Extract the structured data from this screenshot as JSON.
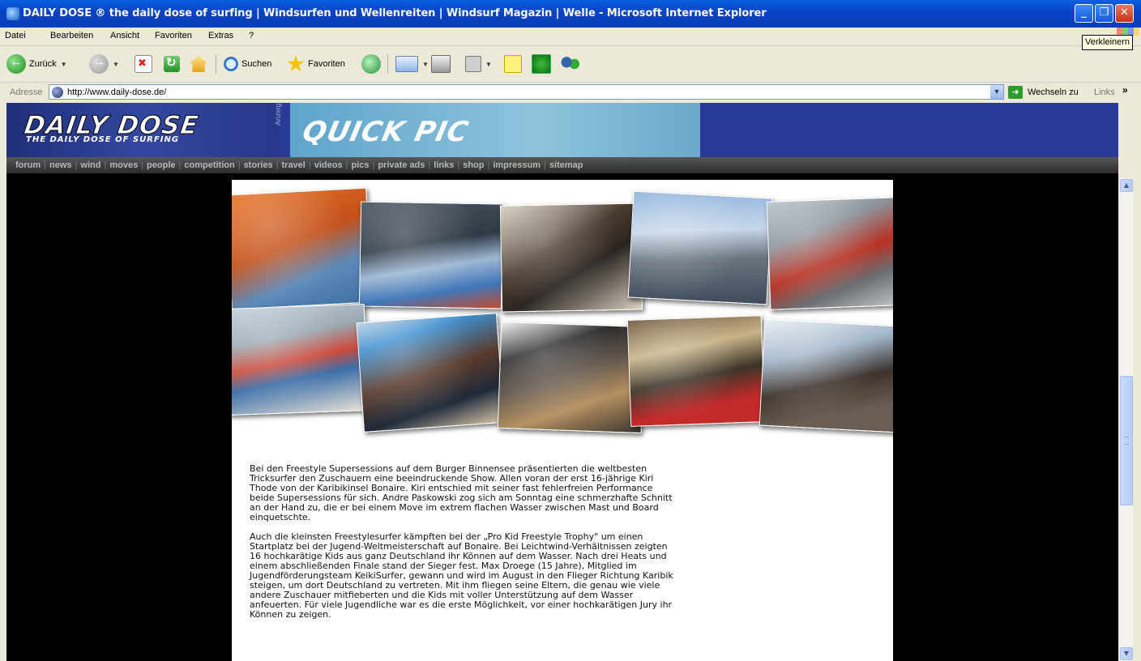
{
  "window": {
    "title": "DAILY DOSE ® the daily dose of surfing | Windsurfen und Wellenreiten | Windsurf Magazin | Welle - Microsoft Internet Explorer",
    "tooltip": "Verkleinern"
  },
  "menu": {
    "items": [
      "Datei",
      "Bearbeiten",
      "Ansicht",
      "Favoriten",
      "Extras",
      "?"
    ]
  },
  "toolbar": {
    "back_label": "Zurück",
    "search_label": "Suchen",
    "favorites_label": "Favoriten"
  },
  "address": {
    "label": "Adresse",
    "url": "http://www.daily-dose.de/",
    "go_label": "Wechseln zu",
    "links_label": "Links"
  },
  "site": {
    "logo_main": "DAILY DOSE",
    "logo_sub": "THE DAILY DOSE OF SURFING",
    "ad_label": "Anzeige",
    "ad_text": "QUICK PIC",
    "nav": [
      "forum",
      "news",
      "wind",
      "moves",
      "people",
      "competition",
      "stories",
      "travel",
      "videos",
      "pics",
      "private ads",
      "links",
      "shop",
      "impressum",
      "sitemap"
    ]
  },
  "article": {
    "p1": "Bei den Freestyle Supersessions auf dem Burger Binnensee präsentierten die weltbesten\nTricksurfer den Zuschauern eine beeindruckende Show. Allen voran der erst 16-jährige Kiri\nThode von der Karibikinsel Bonaire. Kiri entschied mit seiner fast fehlerfreien Performance\nbeide Supersessions für sich. Andre Paskowski zog sich am Sonntag eine schmerzhafte Schnitt\nan der Hand zu, die er bei einem Move im extrem flachen Wasser zwischen Mast und Board\neinquetschte.",
    "p2": "Auch die kleinsten Freestylesurfer kämpften bei der „Pro Kid Freestyle Trophy\" um einen\nStartplatz bei der Jugend-Weltmeisterschaft auf Bonaire. Bei Leichtwind-Verhältnissen zeigten\n16 hochkarätige Kids aus ganz Deutschland ihr Können auf dem Wasser. Nach drei Heats und\neinem abschließenden Finale stand der Sieger fest. Max Droege (15 Jahre), Mitglied im\nJugendförderungsteam KeikiSurfer, gewann und wird im August in den Flieger Richtung Karibik\nsteigen, um dort Deutschland zu vertreten. Mit ihm fliegen seine Eltern, die genau wie viele\nandere Zuschauer mitfieberten und die Kids mit voller Unterstützung auf dem Wasser\nanfeuerten. Für viele Jugendliche war es die erste Möglichkeit, vor einer hochkarätigen Jury ihr\nKönnen zu zeigen."
  },
  "colors": {
    "titlebar": "#0a4fd6",
    "site_header": "#2a3a98",
    "nav_text": "#b8b8b8"
  }
}
